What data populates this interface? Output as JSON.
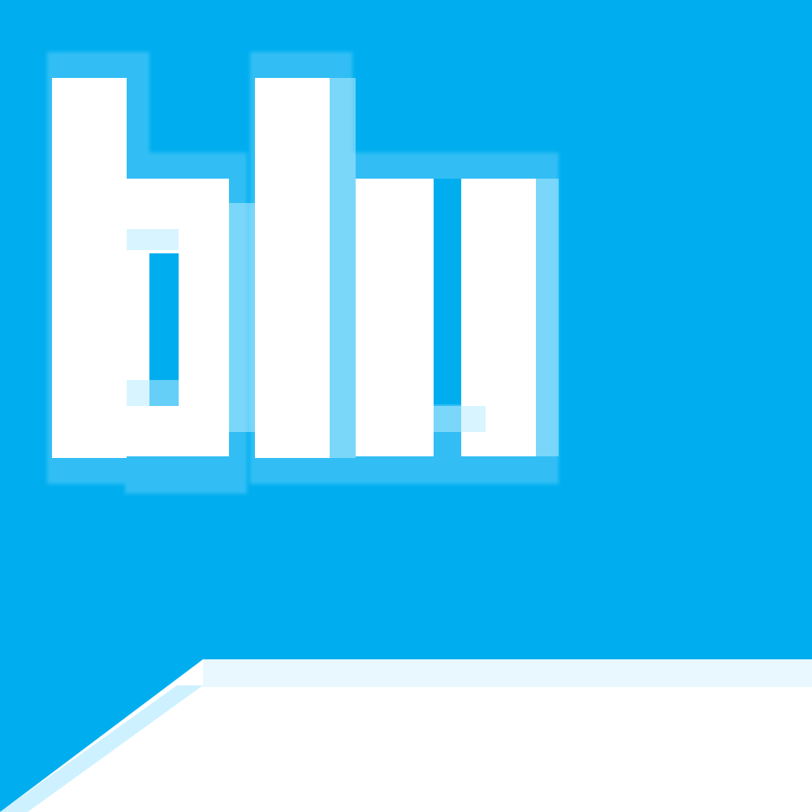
{
  "logo": {
    "text": "blu",
    "icon": "blu-logo-icon",
    "background_color": "#00aeef",
    "foreground_color": "#ffffff"
  },
  "decoration": {
    "icon": "white-diagonal-wedge",
    "color": "#ffffff"
  }
}
